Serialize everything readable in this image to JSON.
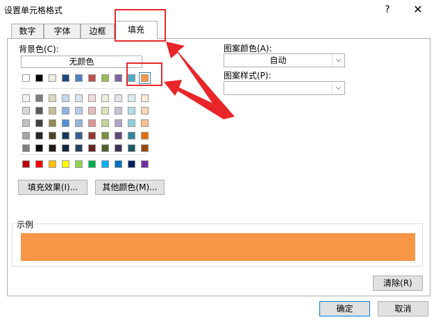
{
  "window": {
    "title": "设置单元格格式",
    "help_label": "?",
    "close_label": "✕"
  },
  "tabs": [
    {
      "label": "数字",
      "active": false
    },
    {
      "label": "字体",
      "active": false
    },
    {
      "label": "边框",
      "active": false
    },
    {
      "label": "填充",
      "active": true
    }
  ],
  "fill": {
    "background_label": "背景色(C):",
    "no_color_label": "无颜色",
    "pattern_color_label": "图案颜色(A):",
    "pattern_color_value": "自动",
    "pattern_style_label": "图案样式(P):",
    "pattern_style_value": "",
    "fill_effects_label": "填充效果(I)...",
    "more_colors_label": "其他颜色(M)...",
    "sample_label": "示例",
    "sample_color": "#f79646",
    "clear_label": "清除(R)",
    "selected_swatch": "#f79646",
    "theme_row": [
      "#ffffff",
      "#000000",
      "#eeece1",
      "#1f497d",
      "#4f81bd",
      "#c0504d",
      "#9bbb59",
      "#8064a2",
      "#4bacc6",
      "#f79646"
    ],
    "tint_rows": [
      [
        "#f2f2f2",
        "#7f7f7f",
        "#ddd9c3",
        "#c6d9f0",
        "#dbe5f1",
        "#f2dcdb",
        "#ebf1dd",
        "#e5e0ec",
        "#dbeef3",
        "#fdeada"
      ],
      [
        "#d8d8d8",
        "#595959",
        "#c4bd97",
        "#8db3e2",
        "#b8cce4",
        "#e5b9b7",
        "#d7e3bc",
        "#ccc1d9",
        "#b7dde8",
        "#fbd5b5"
      ],
      [
        "#bfbfbf",
        "#3f3f3f",
        "#938953",
        "#548dd4",
        "#95b3d7",
        "#d99694",
        "#c3d69b",
        "#b2a2c7",
        "#92cddc",
        "#fac08f"
      ],
      [
        "#a5a5a5",
        "#262626",
        "#494429",
        "#17365d",
        "#366092",
        "#953734",
        "#76923c",
        "#5f497a",
        "#31859b",
        "#e36c09"
      ],
      [
        "#7f7f7f",
        "#0c0c0c",
        "#1d1b10",
        "#0f243e",
        "#244061",
        "#632423",
        "#4f6128",
        "#3f3151",
        "#205867",
        "#974806"
      ]
    ],
    "standard_row": [
      "#c00000",
      "#ff0000",
      "#ffc000",
      "#ffff00",
      "#92d050",
      "#00b050",
      "#00b0f0",
      "#0070c0",
      "#002060",
      "#7030a0"
    ]
  },
  "footer": {
    "ok_label": "确定",
    "cancel_label": "取消"
  },
  "annotation_color": "#e8262a"
}
